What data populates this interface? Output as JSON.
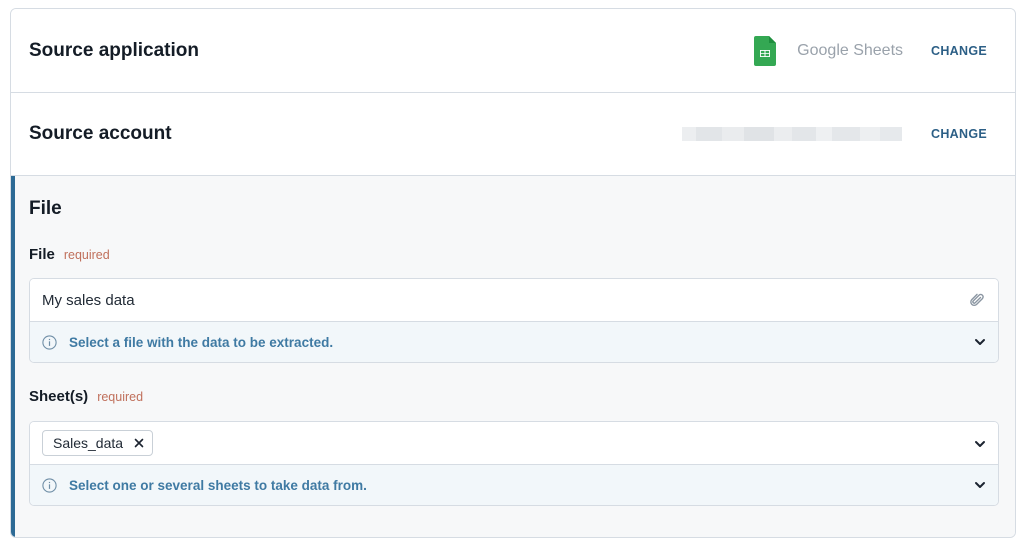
{
  "source_application": {
    "title": "Source application",
    "app_icon": "google-sheets-icon",
    "app_name": "Google Sheets",
    "change_label": "CHANGE",
    "icon_color": "#34a853"
  },
  "source_account": {
    "title": "Source account",
    "account_value_blurred": true,
    "change_label": "CHANGE"
  },
  "file_section": {
    "title": "File",
    "accent_color": "#2d6a95",
    "file_field": {
      "label": "File",
      "required_label": "required",
      "value": "My sales data",
      "hint": "Select a file with the data to be extracted.",
      "icons": [
        "paperclip-icon",
        "info-icon",
        "chevron-down-icon"
      ]
    },
    "sheets_field": {
      "label": "Sheet(s)",
      "required_label": "required",
      "tags": [
        "Sales_data"
      ],
      "hint": "Select one or several sheets to take data from.",
      "icons": [
        "close-icon",
        "info-icon",
        "chevron-down-icon"
      ]
    }
  }
}
